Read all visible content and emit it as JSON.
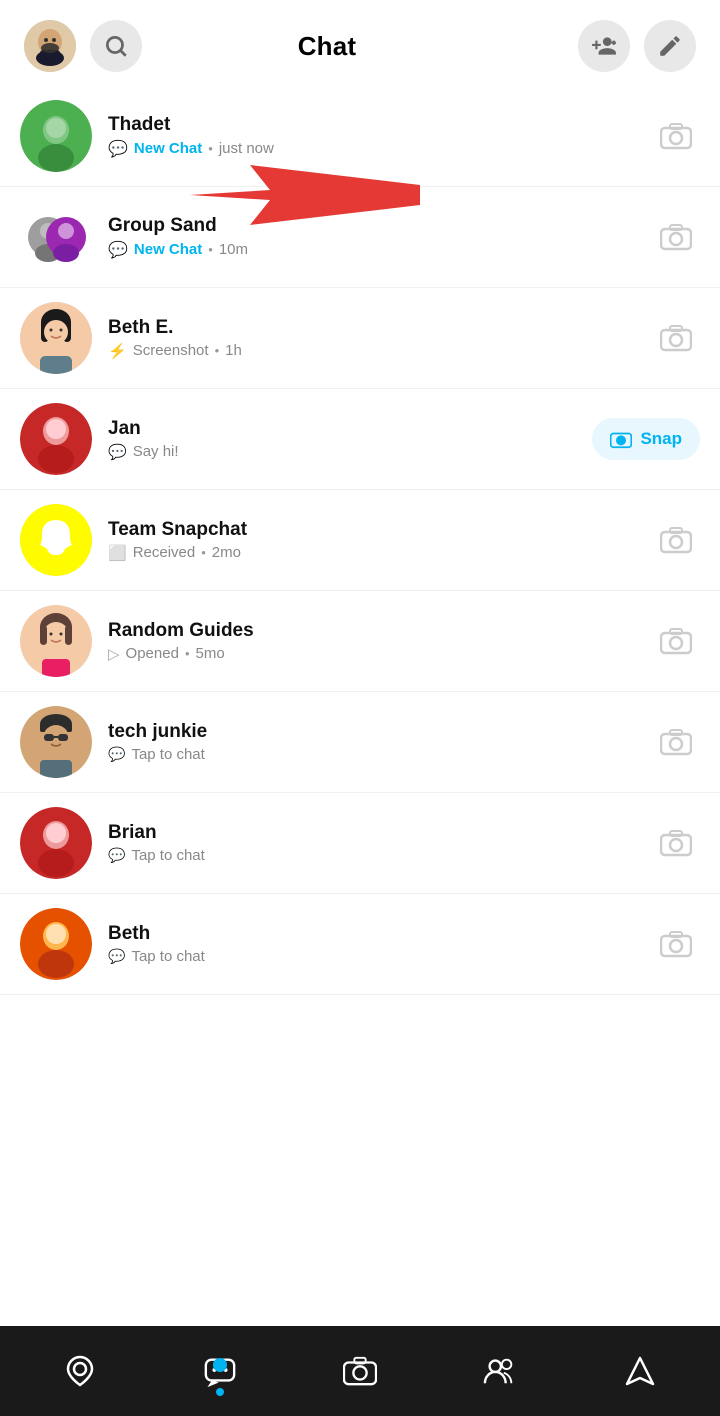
{
  "header": {
    "title": "Chat",
    "add_friend_label": "Add Friend",
    "edit_label": "Edit"
  },
  "annotation": {
    "arrow": "→"
  },
  "chats": [
    {
      "id": "thadet",
      "name": "Thadet",
      "status_label": "New Chat",
      "status_type": "new",
      "time": "just now",
      "avatar_type": "green_person",
      "has_snap_button": false,
      "snap_label": ""
    },
    {
      "id": "group-sand",
      "name": "Group Sand",
      "status_label": "New Chat",
      "status_type": "new",
      "time": "10m",
      "avatar_type": "group",
      "has_snap_button": false,
      "snap_label": ""
    },
    {
      "id": "beth-e",
      "name": "Beth E.",
      "status_label": "Screenshot",
      "status_type": "screenshot",
      "time": "1h",
      "avatar_type": "bitmoji_beth",
      "has_snap_button": false,
      "snap_label": ""
    },
    {
      "id": "jan",
      "name": "Jan",
      "status_label": "Say hi!",
      "status_type": "say_hi",
      "time": "",
      "avatar_type": "red_person",
      "has_snap_button": true,
      "snap_label": "Snap"
    },
    {
      "id": "team-snapchat",
      "name": "Team Snapchat",
      "status_label": "Received",
      "status_type": "received",
      "time": "2mo",
      "avatar_type": "snapchat_logo",
      "has_snap_button": false,
      "snap_label": ""
    },
    {
      "id": "random-guides",
      "name": "Random Guides",
      "status_label": "Opened",
      "status_type": "opened",
      "time": "5mo",
      "avatar_type": "bitmoji_girl",
      "has_snap_button": false,
      "snap_label": ""
    },
    {
      "id": "tech-junkie",
      "name": "tech junkie",
      "status_label": "Tap to chat",
      "status_type": "tap",
      "time": "",
      "avatar_type": "bitmoji_guy",
      "has_snap_button": false,
      "snap_label": ""
    },
    {
      "id": "brian",
      "name": "Brian",
      "status_label": "Tap to chat",
      "status_type": "tap",
      "time": "",
      "avatar_type": "red_person2",
      "has_snap_button": false,
      "snap_label": ""
    },
    {
      "id": "beth",
      "name": "Beth",
      "status_label": "Tap to chat",
      "status_type": "tap",
      "time": "",
      "avatar_type": "orange_person",
      "has_snap_button": false,
      "snap_label": ""
    }
  ],
  "bottom_nav": {
    "items": [
      {
        "id": "map",
        "label": "Map",
        "active": false
      },
      {
        "id": "chat",
        "label": "Chat",
        "active": true
      },
      {
        "id": "camera",
        "label": "Camera",
        "active": false
      },
      {
        "id": "friends",
        "label": "Friends",
        "active": false
      },
      {
        "id": "discover",
        "label": "Discover",
        "active": false
      }
    ]
  },
  "camera_icon_label": "camera",
  "status_icons": {
    "new_chat": "💬",
    "screenshot": "⚡",
    "say_hi": "💬",
    "received": "⬜",
    "opened": "▷",
    "tap": "💬"
  }
}
